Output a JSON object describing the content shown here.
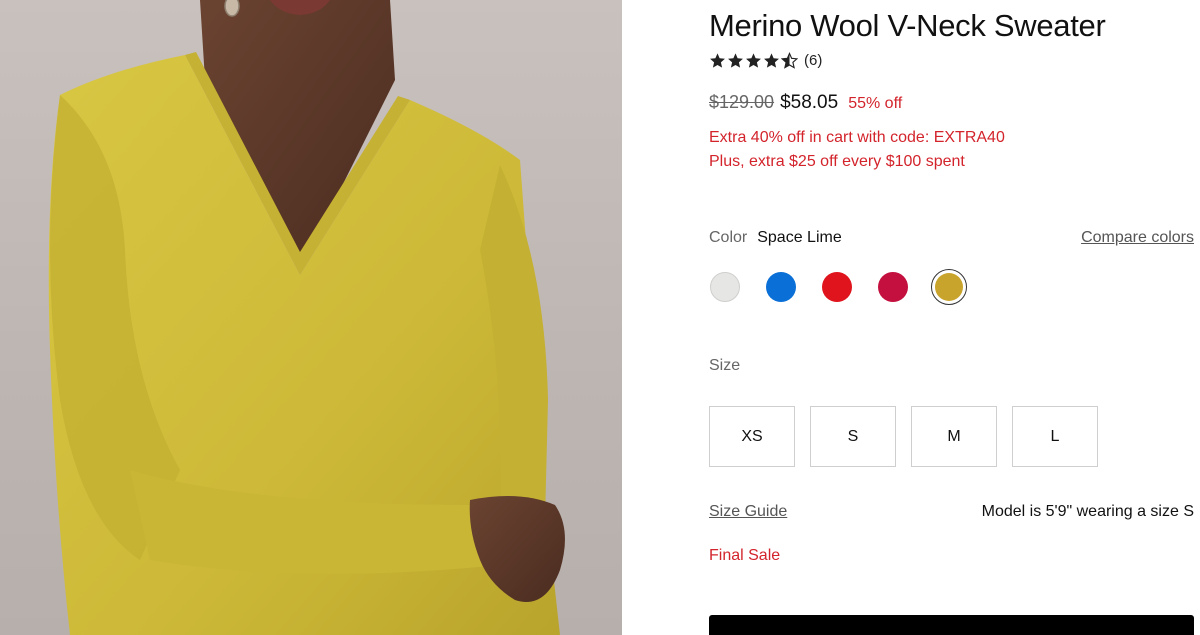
{
  "product": {
    "title": "Merino Wool V-Neck Sweater",
    "rating": {
      "stars": 4.5,
      "count_label": "(6)"
    },
    "price": {
      "original": "$129.00",
      "sale": "$58.05",
      "discount": "55% off"
    },
    "promos": [
      "Extra 40% off in cart with code: EXTRA40",
      "Plus, extra $25 off every $100 spent"
    ],
    "color": {
      "label": "Color",
      "selected": "Space Lime",
      "compare_label": "Compare colors",
      "swatches": [
        {
          "name": "light-gray",
          "hex": "#e6e6e4"
        },
        {
          "name": "blue",
          "hex": "#0a6fd6"
        },
        {
          "name": "red",
          "hex": "#e0141c"
        },
        {
          "name": "raspberry",
          "hex": "#c4103f"
        },
        {
          "name": "space-lime",
          "hex": "#c9a42c",
          "selected": true
        }
      ]
    },
    "size": {
      "label": "Size",
      "options": [
        "XS",
        "S",
        "M",
        "L"
      ],
      "guide_label": "Size Guide",
      "model_info": "Model is 5'9\" wearing a size S"
    },
    "final_sale": "Final Sale"
  },
  "colors": {
    "accent_red": "#d3242c",
    "sweater": "#d2c03a"
  }
}
